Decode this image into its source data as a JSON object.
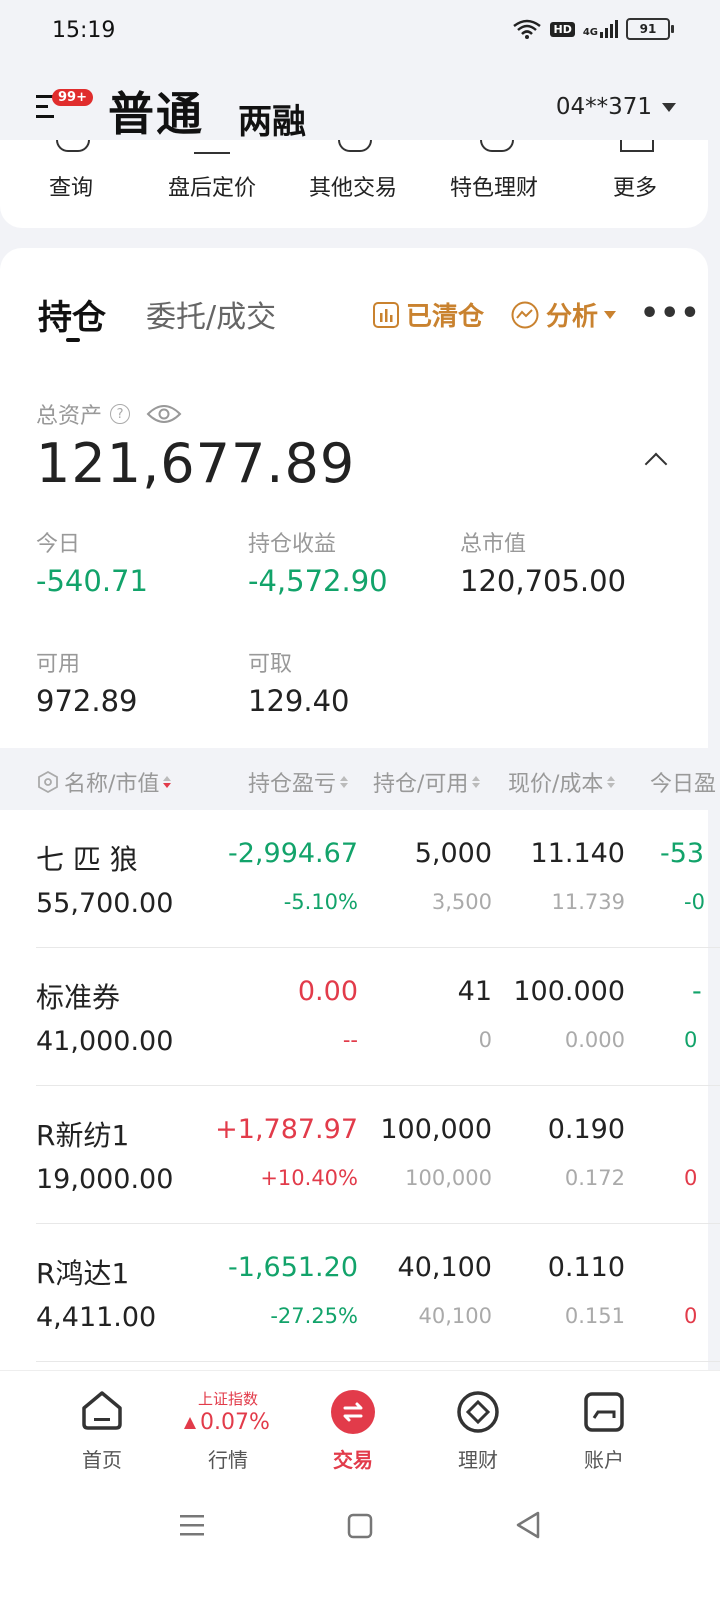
{
  "status_bar": {
    "time": "15:19",
    "battery": "91",
    "hd": "HD",
    "net": "4G"
  },
  "header": {
    "title": "普通",
    "subtitle": "两融",
    "badge": "99+",
    "account": "04**371"
  },
  "shortcuts": [
    "查询",
    "盘后定价",
    "其他交易",
    "特色理财",
    "更多"
  ],
  "tabs": {
    "active": "持仓",
    "inactive": "委托/成交"
  },
  "tools": {
    "cleared": "已清仓",
    "analysis": "分析"
  },
  "summary": {
    "total_label": "总资产",
    "total_value": "121,677.89",
    "today_label": "今日",
    "today_value": "-540.71",
    "pnl_label": "持仓收益",
    "pnl_value": "-4,572.90",
    "mktval_label": "总市值",
    "mktval_value": "120,705.00",
    "avail_label": "可用",
    "avail_value": "972.89",
    "withdraw_label": "可取",
    "withdraw_value": "129.40"
  },
  "columns": [
    "名称/市值",
    "持仓盈亏",
    "持仓/可用",
    "现价/成本",
    "今日盈"
  ],
  "positions": [
    {
      "name": "七 匹 狼",
      "mv": "55,700.00",
      "pl": "-2,994.67",
      "plp": "-5.10%",
      "qty": "5,000",
      "avail": "3,500",
      "price": "11.140",
      "cost": "11.739",
      "today": "-53",
      "todayp": "-0",
      "color": "green"
    },
    {
      "name": "标准券",
      "mv": "41,000.00",
      "pl": "0.00",
      "plp": "--",
      "qty": "41",
      "avail": "0",
      "price": "100.000",
      "cost": "0.000",
      "today": "-",
      "todayp": "0",
      "color": "red"
    },
    {
      "name": "R新纺1",
      "mv": "19,000.00",
      "pl": "+1,787.97",
      "plp": "+10.40%",
      "qty": "100,000",
      "avail": "100,000",
      "price": "0.190",
      "cost": "0.172",
      "today": "",
      "todayp": "0",
      "color": "red"
    },
    {
      "name": "R鸿达1",
      "mv": "4,411.00",
      "pl": "-1,651.20",
      "plp": "-27.25%",
      "qty": "40,100",
      "avail": "40,100",
      "price": "0.110",
      "cost": "0.151",
      "today": "",
      "todayp": "0",
      "color": "green"
    }
  ],
  "bottom_nav": {
    "home": "首页",
    "market": "行情",
    "market_index_name": "上证指数",
    "market_index_change": "0.07%",
    "trade": "交易",
    "wealth": "理财",
    "account": "账户"
  },
  "colors": {
    "up": "#e23b4a",
    "down": "#12a36a",
    "accent": "#c9822f"
  }
}
